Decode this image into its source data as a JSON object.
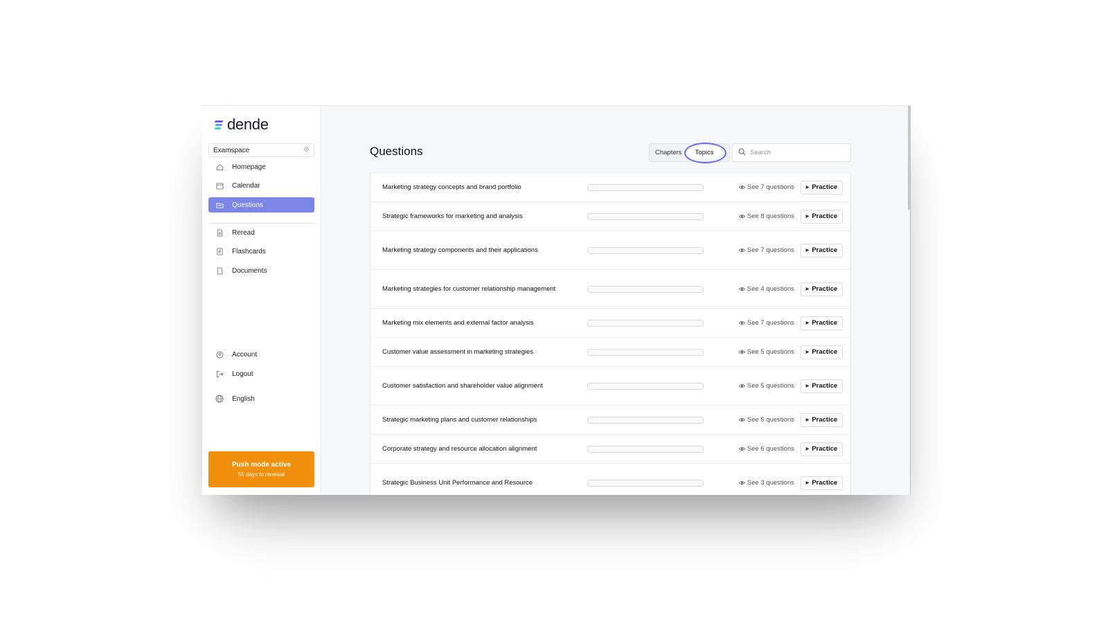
{
  "brand": {
    "name": "dende",
    "colors": [
      "#6a5cf0",
      "#4aa4f0",
      "#3ccfd0"
    ]
  },
  "sidebar": {
    "workspace": {
      "label": "Examspace",
      "icon": "gear-icon"
    },
    "items": [
      {
        "label": "Homepage",
        "icon": "home-icon"
      },
      {
        "label": "Calendar",
        "icon": "calendar-icon"
      },
      {
        "label": "Questions",
        "icon": "folder-icon",
        "active": true
      },
      {
        "label": "Reread",
        "icon": "document-icon"
      },
      {
        "label": "Flashcards",
        "icon": "flashcards-icon"
      },
      {
        "label": "Documents",
        "icon": "file-icon"
      }
    ],
    "bottom_items": [
      {
        "label": "Account",
        "icon": "user-icon"
      },
      {
        "label": "Logout",
        "icon": "logout-icon"
      },
      {
        "label": "English",
        "icon": "globe-icon"
      }
    ],
    "push": {
      "title": "Push mode active",
      "subtitle": "55 days to renewal",
      "color": "#f0900c"
    }
  },
  "main": {
    "title": "Questions",
    "tabs": [
      {
        "label": "Chapters"
      },
      {
        "label": "Topics",
        "selected": true
      }
    ],
    "search": {
      "placeholder": "Search",
      "value": ""
    },
    "accent": "#7b86e8",
    "rows": [
      {
        "title": "Marketing strategy concepts and brand portfolio",
        "progress": 0,
        "see": "See 7 questions",
        "action": "Practice"
      },
      {
        "title": "Strategic frameworks for marketing and analysis",
        "progress": 0,
        "see": "See 8 questions",
        "action": "Practice"
      },
      {
        "title": "Marketing strategy components and their applications",
        "progress": 0,
        "see": "See 7 questions",
        "action": "Practice"
      },
      {
        "title": "Marketing strategies for customer relationship management",
        "progress": 0,
        "see": "See 4 questions",
        "action": "Practice"
      },
      {
        "title": "Marketing mix elements and external factor analysis",
        "progress": 0,
        "see": "See 7 questions",
        "action": "Practice"
      },
      {
        "title": "Customer value assessment in marketing strategies",
        "progress": 0,
        "see": "See 5 questions",
        "action": "Practice"
      },
      {
        "title": "Customer satisfaction and shareholder value alignment",
        "progress": 0,
        "see": "See 5 questions",
        "action": "Practice"
      },
      {
        "title": "Strategic marketing plans and customer relationships",
        "progress": 0,
        "see": "See 6 questions",
        "action": "Practice"
      },
      {
        "title": "Corporate strategy and resource allocation alignment",
        "progress": 0,
        "see": "See 6 questions",
        "action": "Practice"
      },
      {
        "title": "Strategic Business Unit Performance and Resource",
        "progress": 0,
        "see": "See 3 questions",
        "action": "Practice"
      }
    ]
  }
}
